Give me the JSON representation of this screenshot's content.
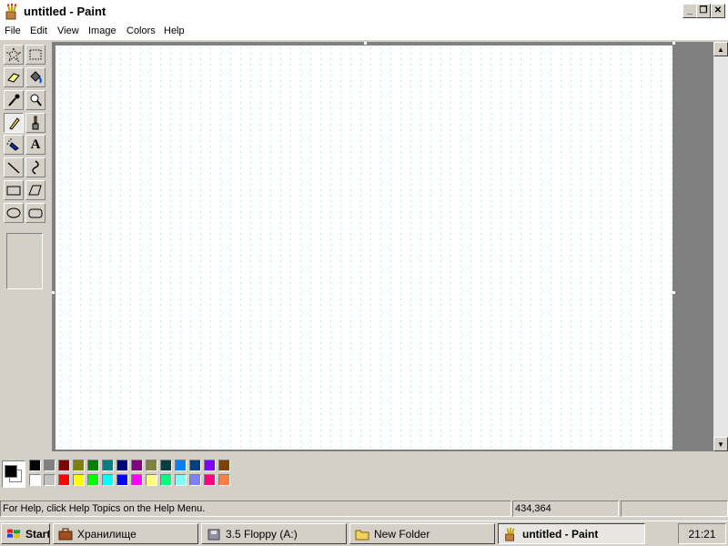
{
  "window": {
    "title": "untitled - Paint",
    "controls": {
      "minimize": "_",
      "restore": "❐",
      "close": "✕"
    }
  },
  "menu": {
    "items": [
      "File",
      "Edit",
      "View",
      "Image",
      "Colors",
      "Help"
    ]
  },
  "toolbox": {
    "tools": [
      {
        "name": "free-form-select",
        "icon": "star-select-icon",
        "active": false
      },
      {
        "name": "rectangle-select",
        "icon": "rect-select-icon",
        "active": false
      },
      {
        "name": "eraser",
        "icon": "eraser-icon",
        "active": false
      },
      {
        "name": "fill",
        "icon": "fill-bucket-icon",
        "active": false
      },
      {
        "name": "pick-color",
        "icon": "eyedropper-icon",
        "active": false
      },
      {
        "name": "magnifier",
        "icon": "magnifier-icon",
        "active": false
      },
      {
        "name": "pencil",
        "icon": "pencil-icon",
        "active": true
      },
      {
        "name": "brush",
        "icon": "brush-icon",
        "active": false
      },
      {
        "name": "airbrush",
        "icon": "airbrush-icon",
        "active": false
      },
      {
        "name": "text",
        "icon": "text-icon",
        "glyph": "A",
        "active": false
      },
      {
        "name": "line",
        "icon": "line-icon",
        "active": false
      },
      {
        "name": "curve",
        "icon": "curve-icon",
        "active": false
      },
      {
        "name": "rectangle",
        "icon": "rectangle-icon",
        "active": false
      },
      {
        "name": "polygon",
        "icon": "polygon-icon",
        "active": false
      },
      {
        "name": "ellipse",
        "icon": "ellipse-icon",
        "active": false
      },
      {
        "name": "rounded-rectangle",
        "icon": "rounded-rect-icon",
        "active": false
      }
    ]
  },
  "palette": {
    "foreground": "#000000",
    "background": "#ffffff",
    "row1": [
      "#000000",
      "#808080",
      "#800000",
      "#808000",
      "#008000",
      "#008080",
      "#000080",
      "#800080",
      "#808040",
      "#004040",
      "#0080ff",
      "#004080",
      "#8000ff",
      "#804000"
    ],
    "row2": [
      "#ffffff",
      "#c0c0c0",
      "#ff0000",
      "#ffff00",
      "#00ff00",
      "#00ffff",
      "#0000ff",
      "#ff00ff",
      "#ffff80",
      "#00ff80",
      "#80ffff",
      "#8080ff",
      "#ff0080",
      "#ff8040"
    ]
  },
  "status": {
    "help_text": "For Help, click Help Topics on the Help Menu.",
    "coordinates": "434,364",
    "size": ""
  },
  "taskbar": {
    "start_label": "Start",
    "tasks": [
      {
        "label": "Хранилище",
        "icon": "briefcase-icon",
        "active": false
      },
      {
        "label": "3.5 Floppy (A:)",
        "icon": "floppy-drive-icon",
        "active": false
      },
      {
        "label": "New Folder",
        "icon": "folder-icon",
        "active": false
      },
      {
        "label": "untitled - Paint",
        "icon": "paint-icon",
        "active": true
      }
    ],
    "clock": "21:21"
  }
}
